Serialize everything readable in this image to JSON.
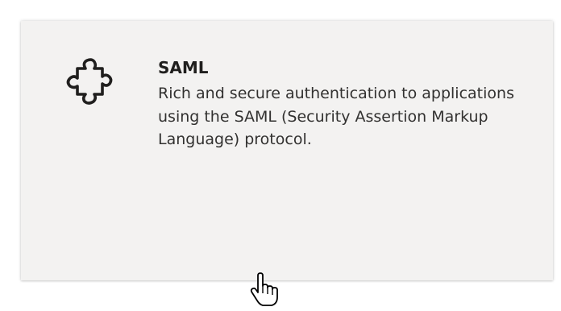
{
  "card": {
    "icon": "puzzle-piece-icon",
    "title": "SAML",
    "description": "Rich and secure authentication to applications using the SAML (Security Assertion Markup Language) protocol."
  },
  "pointer": {
    "icon": "hand-pointer-cursor-icon"
  },
  "colors": {
    "card_background": "#f3f2f1",
    "title_text": "#201f1e",
    "body_text": "#323130"
  }
}
